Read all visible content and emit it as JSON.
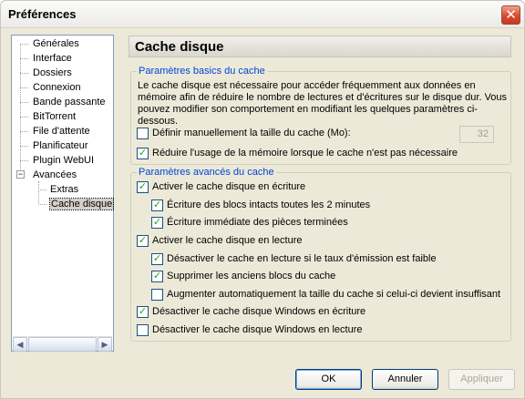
{
  "window": {
    "title": "Préférences"
  },
  "tree": {
    "items": [
      {
        "label": "Générales"
      },
      {
        "label": "Interface"
      },
      {
        "label": "Dossiers"
      },
      {
        "label": "Connexion"
      },
      {
        "label": "Bande passante"
      },
      {
        "label": "BitTorrent"
      },
      {
        "label": "File d'attente"
      },
      {
        "label": "Planificateur"
      },
      {
        "label": "Plugin WebUI"
      },
      {
        "label": "Avancées"
      },
      {
        "label": "Extras"
      },
      {
        "label": "Cache disque"
      }
    ],
    "expander_symbol": "−",
    "scroll_left": "◀",
    "scroll_right": "▶"
  },
  "page": {
    "title": "Cache disque",
    "basic": {
      "legend": "Paramètres basics du cache",
      "description": "Le cache disque est nécessaire pour accéder fréquemment aux données en mémoire afin de réduire le nombre de lectures et d'écritures sur le disque dur. Vous pouvez modifier son comportement en modifiant les quelques paramètres ci-dessous.",
      "manual_size": {
        "label": "Définir manuellement la taille du cache (Mo):",
        "checked": false
      },
      "cache_size_value": "32",
      "reduce_memory": {
        "label": "Réduire l'usage de la mémoire lorsque le cache n'est pas nécessaire",
        "checked": true
      }
    },
    "advanced": {
      "legend": "Paramètres avancés du cache",
      "write_cache": {
        "label": "Activer le cache disque en écriture",
        "checked": true
      },
      "write_intact": {
        "label": "Écriture des blocs intacts toutes les 2 minutes",
        "checked": true
      },
      "write_immediate": {
        "label": "Écriture immédiate des pièces terminées",
        "checked": true
      },
      "read_cache": {
        "label": "Activer le cache disque en lecture",
        "checked": true
      },
      "disable_read_high": {
        "label": "Désactiver le cache en lecture si le taux d'émission est faible",
        "checked": true
      },
      "remove_old": {
        "label": "Supprimer les anciens blocs du cache",
        "checked": true
      },
      "auto_increase": {
        "label": "Augmenter automatiquement la taille du cache si celui-ci devient insuffisant",
        "checked": false
      },
      "disable_win_write": {
        "label": "Désactiver le cache disque Windows en écriture",
        "checked": true
      },
      "disable_win_read": {
        "label": "Désactiver le cache disque Windows en lecture",
        "checked": false
      }
    }
  },
  "buttons": {
    "ok": "OK",
    "cancel": "Annuler",
    "apply": "Appliquer"
  },
  "close_glyph": "✕",
  "check_glyph": "✓",
  "colors": {
    "legend": "#0046d5",
    "check": "#21a121",
    "close": "#d9492b"
  }
}
